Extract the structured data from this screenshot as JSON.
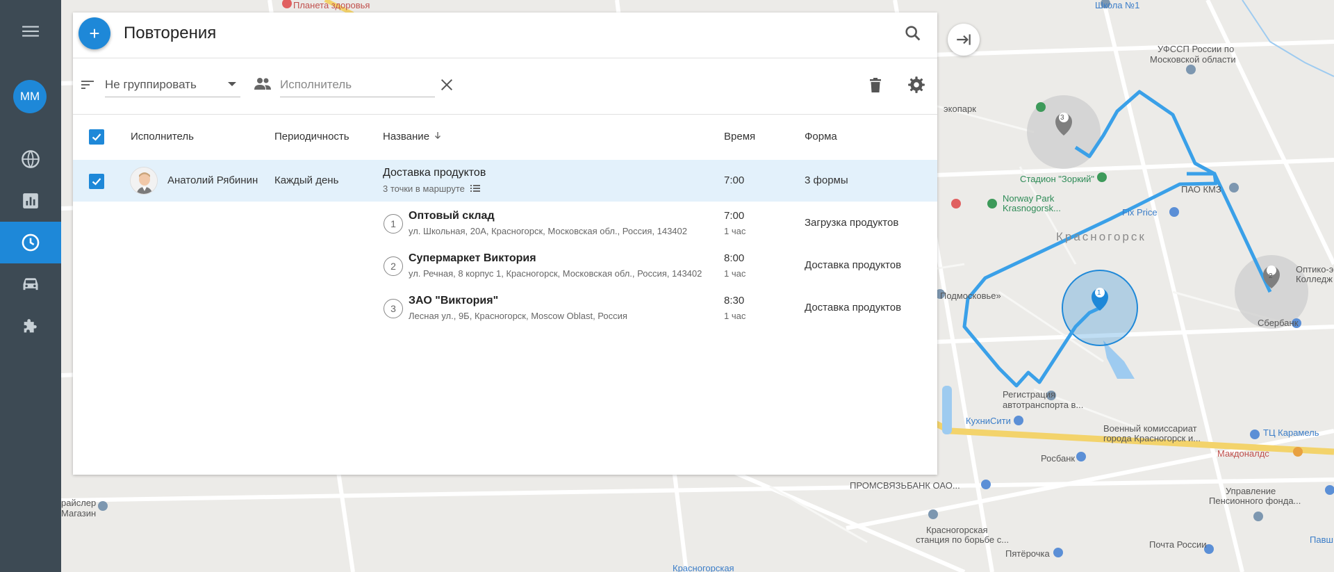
{
  "header": {
    "title": "Повторения",
    "add_label": "+"
  },
  "toolbar": {
    "group_by_value": "Не группировать",
    "assignee_placeholder": "Исполнитель"
  },
  "sidebar": {
    "user_initials": "ММ",
    "items": [
      {
        "icon": "globe-icon",
        "active": false
      },
      {
        "icon": "bar-chart-icon",
        "active": false
      },
      {
        "icon": "clock-icon",
        "active": true
      },
      {
        "icon": "car-icon",
        "active": false
      },
      {
        "icon": "puzzle-icon",
        "active": false
      }
    ]
  },
  "table": {
    "columns": {
      "assignee": "Исполнитель",
      "periodicity": "Периодичность",
      "name": "Название",
      "time": "Время",
      "form": "Форма"
    },
    "row": {
      "assignee": "Анатолий Рябинин",
      "periodicity": "Каждый день",
      "name": "Доставка продуктов",
      "route_info": "3 точки в маршруте",
      "time": "7:00",
      "form": "3 формы"
    },
    "stops": [
      {
        "num": "1",
        "name": "Оптовый склад",
        "address": "ул. Школьная, 20А, Красногорск, Московская обл., Россия, 143402",
        "time": "7:00",
        "duration": "1 час",
        "form": "Загрузка продуктов"
      },
      {
        "num": "2",
        "name": "Супермаркет Виктория",
        "address": "ул. Речная, 8 корпус 1, Красногорск, Московская обл., Россия, 143402",
        "time": "8:00",
        "duration": "1 час",
        "form": "Доставка продуктов"
      },
      {
        "num": "3",
        "name": "ЗАО \"Виктория\"",
        "address": "Лесная ул., 9Б, Красногорск, Moscow Oblast, Россия",
        "time": "8:30",
        "duration": "1 час",
        "form": "Доставка продуктов"
      }
    ]
  },
  "map": {
    "labels": {
      "planeta": "Планета здоровья",
      "shkola": "Школа №1",
      "uffsp": "УФССП России по",
      "uffsp2": "Московской области",
      "ekopark": "экопарк",
      "stadion": "Стадион \"Зоркий\"",
      "norway": "Norway Park",
      "norway2": "Krasnogorsk...",
      "pao": "ПАО КМЗ",
      "fixprice": "Fix Price",
      "city": "Красногорск",
      "podmoskovye": "Подмосковье»",
      "optiko": "Оптико-э",
      "kolledzh": "Колледж",
      "sberbank": "Сбербанк",
      "registracia": "Регистрация",
      "avtotransport": "автотранспорта в...",
      "kukhni": "КухниСити",
      "voenkomat": "Военный комиссариат",
      "voenkomat2": "города Красногорск и...",
      "tc": "ТЦ Карамель",
      "mcd": "Макдоналдс",
      "rosbank": "Росбанк",
      "promsvyaz": "ПРОМСВЯЗЬБАНК ОАО...",
      "stanciya": "Красногорская",
      "stanciya2": "станция по борьбе с...",
      "pyaterochka": "Пятёрочка",
      "pochta": "Почта России",
      "upravlenie": "Управление",
      "upravlenie2": "Пенсионного фонда...",
      "kraysler": "райслер",
      "magazin": "Магазин",
      "pavsh": "Павш",
      "krasnogorskaya": "Красногорская",
      "marker1": "1",
      "marker2": "2",
      "marker3": "3"
    }
  }
}
